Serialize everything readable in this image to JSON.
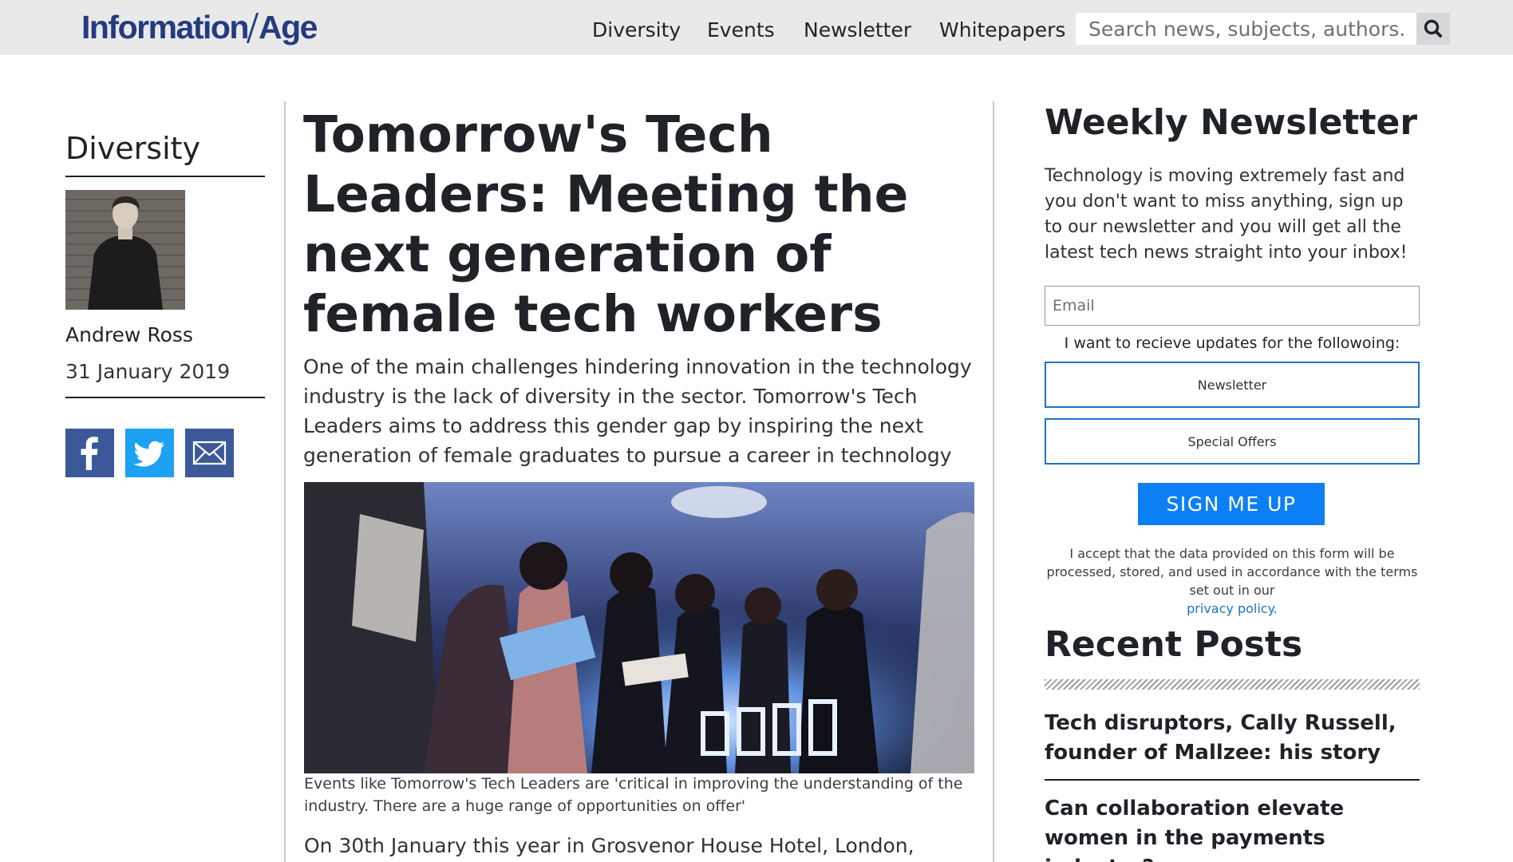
{
  "site": {
    "logo_part1": "Information",
    "logo_part2": "Age"
  },
  "nav": {
    "items": [
      {
        "label": "Diversity"
      },
      {
        "label": "Events"
      },
      {
        "label": "Newsletter"
      },
      {
        "label": "Whitepapers"
      }
    ],
    "search_placeholder": "Search news, subjects, authors..."
  },
  "article": {
    "category": "Diversity",
    "author": "Andrew Ross",
    "date": "31 January 2019",
    "share": [
      "facebook",
      "twitter",
      "email"
    ],
    "headline": "Tomorrow's Tech Leaders: Meeting the next generation of female tech workers",
    "standfirst": "One of the main challenges hindering innovation in the technology industry is the lack of diversity in the sector. Tomorrow's Tech Leaders aims to address this gender gap by inspiring the next generation of female graduates to pursue a career in technology",
    "image_caption": "Events like Tomorrow's Tech Leaders are 'critical in improving the understanding of the industry. There are a huge range of opportunities on offer'",
    "body_start": "On 30th January this year in Grosvenor House Hotel, London,"
  },
  "newsletter": {
    "heading": "Weekly Newsletter",
    "description": "Technology is moving extremely fast and you don't want to miss anything, sign up to our newsletter and you will get all the latest tech news straight into your inbox!",
    "email_placeholder": "Email",
    "updates_label": "I want to recieve updates for the followoing:",
    "options": [
      {
        "label": "Newsletter"
      },
      {
        "label": "Special Offers"
      }
    ],
    "submit_label": "SIGN ME UP",
    "legal_text": "I accept that the data provided on this form will be processed, stored, and used in accordance with the terms set out in our",
    "legal_link": "privacy policy."
  },
  "recent": {
    "heading": "Recent Posts",
    "posts": [
      {
        "title": "Tech disruptors, Cally Russell, founder of Mallzee: his story"
      },
      {
        "title": "Can collaboration elevate women in the payments industry?"
      }
    ]
  },
  "colors": {
    "brand": "#253b80",
    "accent": "#0d7ff4",
    "facebook": "#3b5998",
    "twitter": "#1da1f2",
    "email_share": "#3b5998"
  }
}
